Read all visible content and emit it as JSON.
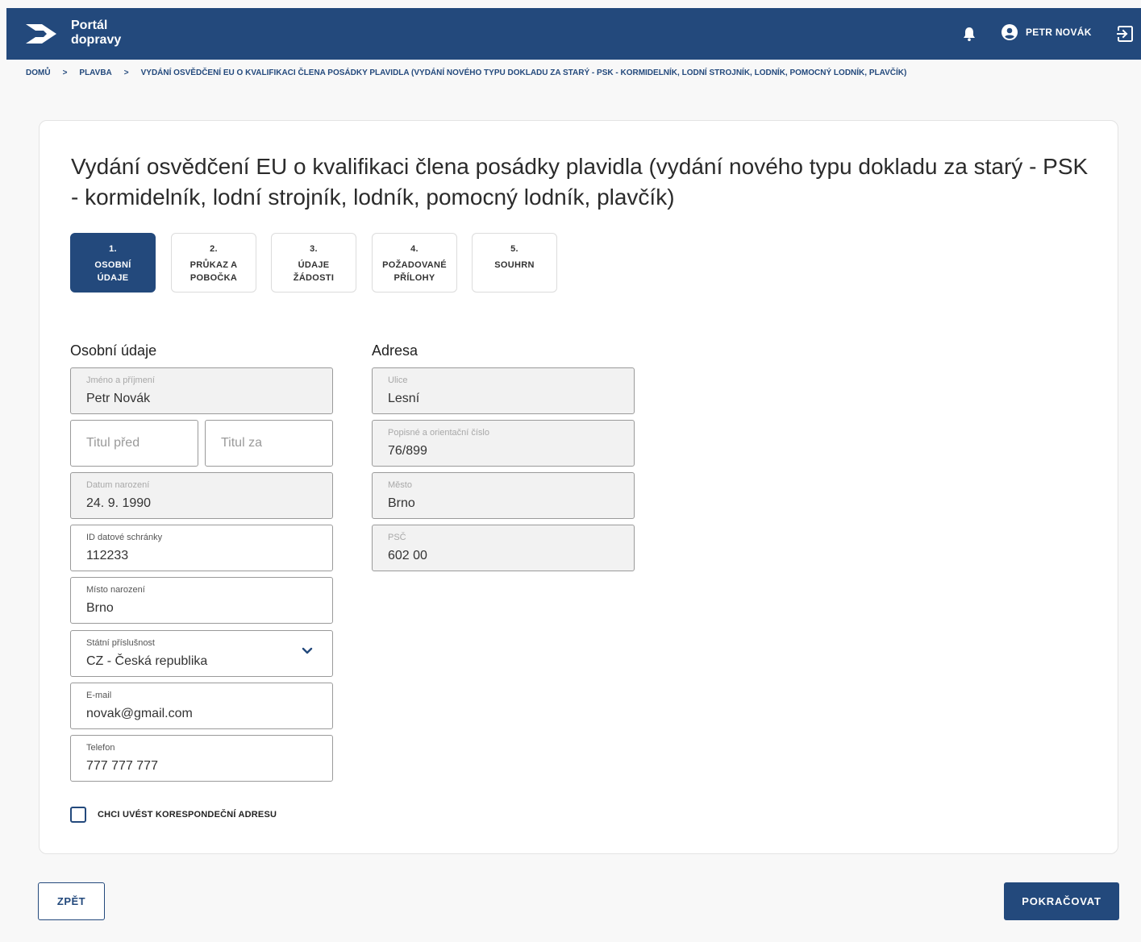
{
  "header": {
    "brand_line1": "Portál",
    "brand_line2": "dopravy",
    "user_name": "PETR NOVÁK",
    "icons": [
      "logo-arrow-icon",
      "bell-icon",
      "user-circle-icon",
      "logout-icon"
    ],
    "colors": {
      "primary": "#23497c",
      "background": "#f8f8f8"
    }
  },
  "breadcrumb": {
    "items": [
      "DOMŮ",
      "PLAVBA",
      "VYDÁNÍ OSVĚDČENÍ EU O KVALIFIKACI ČLENA POSÁDKY PLAVIDLA (VYDÁNÍ NOVÉHO TYPU DOKLADU ZA STARÝ - PSK - KORMIDELNÍK, LODNÍ STROJNÍK, LODNÍK, POMOCNÝ LODNÍK, PLAVČÍK)"
    ],
    "separator": ">"
  },
  "page": {
    "title": "Vydání osvědčení EU o kvalifikaci člena posádky plavidla (vydání nového typu dokladu za starý - PSK - kormidelník, lodní strojník, lodník, pomocný lodník, plavčík)"
  },
  "steps": [
    {
      "num": "1.",
      "label": "OSOBNÍ\nÚDAJE",
      "active": true
    },
    {
      "num": "2.",
      "label": "PRŮKAZ A\nPOBOČKA",
      "active": false
    },
    {
      "num": "3.",
      "label": "ÚDAJE\nŽÁDOSTI",
      "active": false
    },
    {
      "num": "4.",
      "label": "POŽADOVANÉ\nPŘÍLOHY",
      "active": false
    },
    {
      "num": "5.",
      "label": "SOUHRN",
      "active": false
    }
  ],
  "personal": {
    "section_title": "Osobní údaje",
    "name": {
      "label": "Jméno a příjmení",
      "value": "Petr Novák"
    },
    "title_before": {
      "placeholder": "Titul před"
    },
    "title_after": {
      "placeholder": "Titul za"
    },
    "birth_date": {
      "label": "Datum narození",
      "value": "24. 9. 1990"
    },
    "databox_id": {
      "label": "ID datové schránky",
      "value": "112233"
    },
    "birth_place": {
      "label": "Místo narození",
      "value": "Brno"
    },
    "citizenship": {
      "label": "Státní příslušnost",
      "value": "CZ - Česká republika"
    },
    "email": {
      "label": "E-mail",
      "value": "novak@gmail.com"
    },
    "phone": {
      "label": "Telefon",
      "value": "777 777 777"
    }
  },
  "address": {
    "section_title": "Adresa",
    "street": {
      "label": "Ulice",
      "value": "Lesní"
    },
    "house_number": {
      "label": "Popisné a orientační číslo",
      "value": "76/899"
    },
    "city": {
      "label": "Město",
      "value": "Brno"
    },
    "zip": {
      "label": "PSČ",
      "value": "602 00"
    }
  },
  "correspondence": {
    "label": "CHCI UVÉST KORESPONDEČNÍ ADRESU",
    "checked": false
  },
  "actions": {
    "back_label": "ZPĚT",
    "next_label": "POKRAČOVAT"
  }
}
